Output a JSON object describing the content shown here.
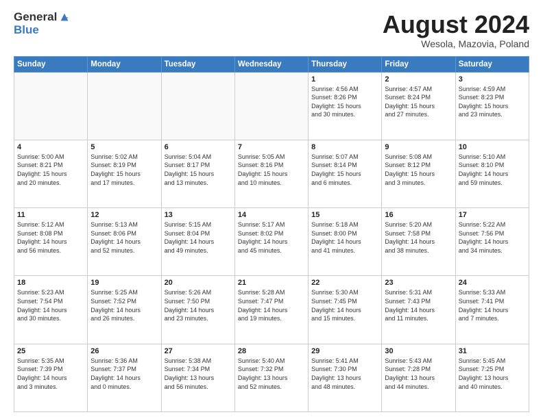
{
  "header": {
    "logo_general": "General",
    "logo_blue": "Blue",
    "month_year": "August 2024",
    "location": "Wesola, Mazovia, Poland"
  },
  "days_of_week": [
    "Sunday",
    "Monday",
    "Tuesday",
    "Wednesday",
    "Thursday",
    "Friday",
    "Saturday"
  ],
  "weeks": [
    [
      {
        "day": "",
        "info": "",
        "empty": true
      },
      {
        "day": "",
        "info": "",
        "empty": true
      },
      {
        "day": "",
        "info": "",
        "empty": true
      },
      {
        "day": "",
        "info": "",
        "empty": true
      },
      {
        "day": "1",
        "info": "Sunrise: 4:56 AM\nSunset: 8:26 PM\nDaylight: 15 hours\nand 30 minutes."
      },
      {
        "day": "2",
        "info": "Sunrise: 4:57 AM\nSunset: 8:24 PM\nDaylight: 15 hours\nand 27 minutes."
      },
      {
        "day": "3",
        "info": "Sunrise: 4:59 AM\nSunset: 8:23 PM\nDaylight: 15 hours\nand 23 minutes."
      }
    ],
    [
      {
        "day": "4",
        "info": "Sunrise: 5:00 AM\nSunset: 8:21 PM\nDaylight: 15 hours\nand 20 minutes."
      },
      {
        "day": "5",
        "info": "Sunrise: 5:02 AM\nSunset: 8:19 PM\nDaylight: 15 hours\nand 17 minutes."
      },
      {
        "day": "6",
        "info": "Sunrise: 5:04 AM\nSunset: 8:17 PM\nDaylight: 15 hours\nand 13 minutes."
      },
      {
        "day": "7",
        "info": "Sunrise: 5:05 AM\nSunset: 8:16 PM\nDaylight: 15 hours\nand 10 minutes."
      },
      {
        "day": "8",
        "info": "Sunrise: 5:07 AM\nSunset: 8:14 PM\nDaylight: 15 hours\nand 6 minutes."
      },
      {
        "day": "9",
        "info": "Sunrise: 5:08 AM\nSunset: 8:12 PM\nDaylight: 15 hours\nand 3 minutes."
      },
      {
        "day": "10",
        "info": "Sunrise: 5:10 AM\nSunset: 8:10 PM\nDaylight: 14 hours\nand 59 minutes."
      }
    ],
    [
      {
        "day": "11",
        "info": "Sunrise: 5:12 AM\nSunset: 8:08 PM\nDaylight: 14 hours\nand 56 minutes."
      },
      {
        "day": "12",
        "info": "Sunrise: 5:13 AM\nSunset: 8:06 PM\nDaylight: 14 hours\nand 52 minutes."
      },
      {
        "day": "13",
        "info": "Sunrise: 5:15 AM\nSunset: 8:04 PM\nDaylight: 14 hours\nand 49 minutes."
      },
      {
        "day": "14",
        "info": "Sunrise: 5:17 AM\nSunset: 8:02 PM\nDaylight: 14 hours\nand 45 minutes."
      },
      {
        "day": "15",
        "info": "Sunrise: 5:18 AM\nSunset: 8:00 PM\nDaylight: 14 hours\nand 41 minutes."
      },
      {
        "day": "16",
        "info": "Sunrise: 5:20 AM\nSunset: 7:58 PM\nDaylight: 14 hours\nand 38 minutes."
      },
      {
        "day": "17",
        "info": "Sunrise: 5:22 AM\nSunset: 7:56 PM\nDaylight: 14 hours\nand 34 minutes."
      }
    ],
    [
      {
        "day": "18",
        "info": "Sunrise: 5:23 AM\nSunset: 7:54 PM\nDaylight: 14 hours\nand 30 minutes."
      },
      {
        "day": "19",
        "info": "Sunrise: 5:25 AM\nSunset: 7:52 PM\nDaylight: 14 hours\nand 26 minutes."
      },
      {
        "day": "20",
        "info": "Sunrise: 5:26 AM\nSunset: 7:50 PM\nDaylight: 14 hours\nand 23 minutes."
      },
      {
        "day": "21",
        "info": "Sunrise: 5:28 AM\nSunset: 7:47 PM\nDaylight: 14 hours\nand 19 minutes."
      },
      {
        "day": "22",
        "info": "Sunrise: 5:30 AM\nSunset: 7:45 PM\nDaylight: 14 hours\nand 15 minutes."
      },
      {
        "day": "23",
        "info": "Sunrise: 5:31 AM\nSunset: 7:43 PM\nDaylight: 14 hours\nand 11 minutes."
      },
      {
        "day": "24",
        "info": "Sunrise: 5:33 AM\nSunset: 7:41 PM\nDaylight: 14 hours\nand 7 minutes."
      }
    ],
    [
      {
        "day": "25",
        "info": "Sunrise: 5:35 AM\nSunset: 7:39 PM\nDaylight: 14 hours\nand 3 minutes."
      },
      {
        "day": "26",
        "info": "Sunrise: 5:36 AM\nSunset: 7:37 PM\nDaylight: 14 hours\nand 0 minutes."
      },
      {
        "day": "27",
        "info": "Sunrise: 5:38 AM\nSunset: 7:34 PM\nDaylight: 13 hours\nand 56 minutes."
      },
      {
        "day": "28",
        "info": "Sunrise: 5:40 AM\nSunset: 7:32 PM\nDaylight: 13 hours\nand 52 minutes."
      },
      {
        "day": "29",
        "info": "Sunrise: 5:41 AM\nSunset: 7:30 PM\nDaylight: 13 hours\nand 48 minutes."
      },
      {
        "day": "30",
        "info": "Sunrise: 5:43 AM\nSunset: 7:28 PM\nDaylight: 13 hours\nand 44 minutes."
      },
      {
        "day": "31",
        "info": "Sunrise: 5:45 AM\nSunset: 7:25 PM\nDaylight: 13 hours\nand 40 minutes."
      }
    ]
  ]
}
